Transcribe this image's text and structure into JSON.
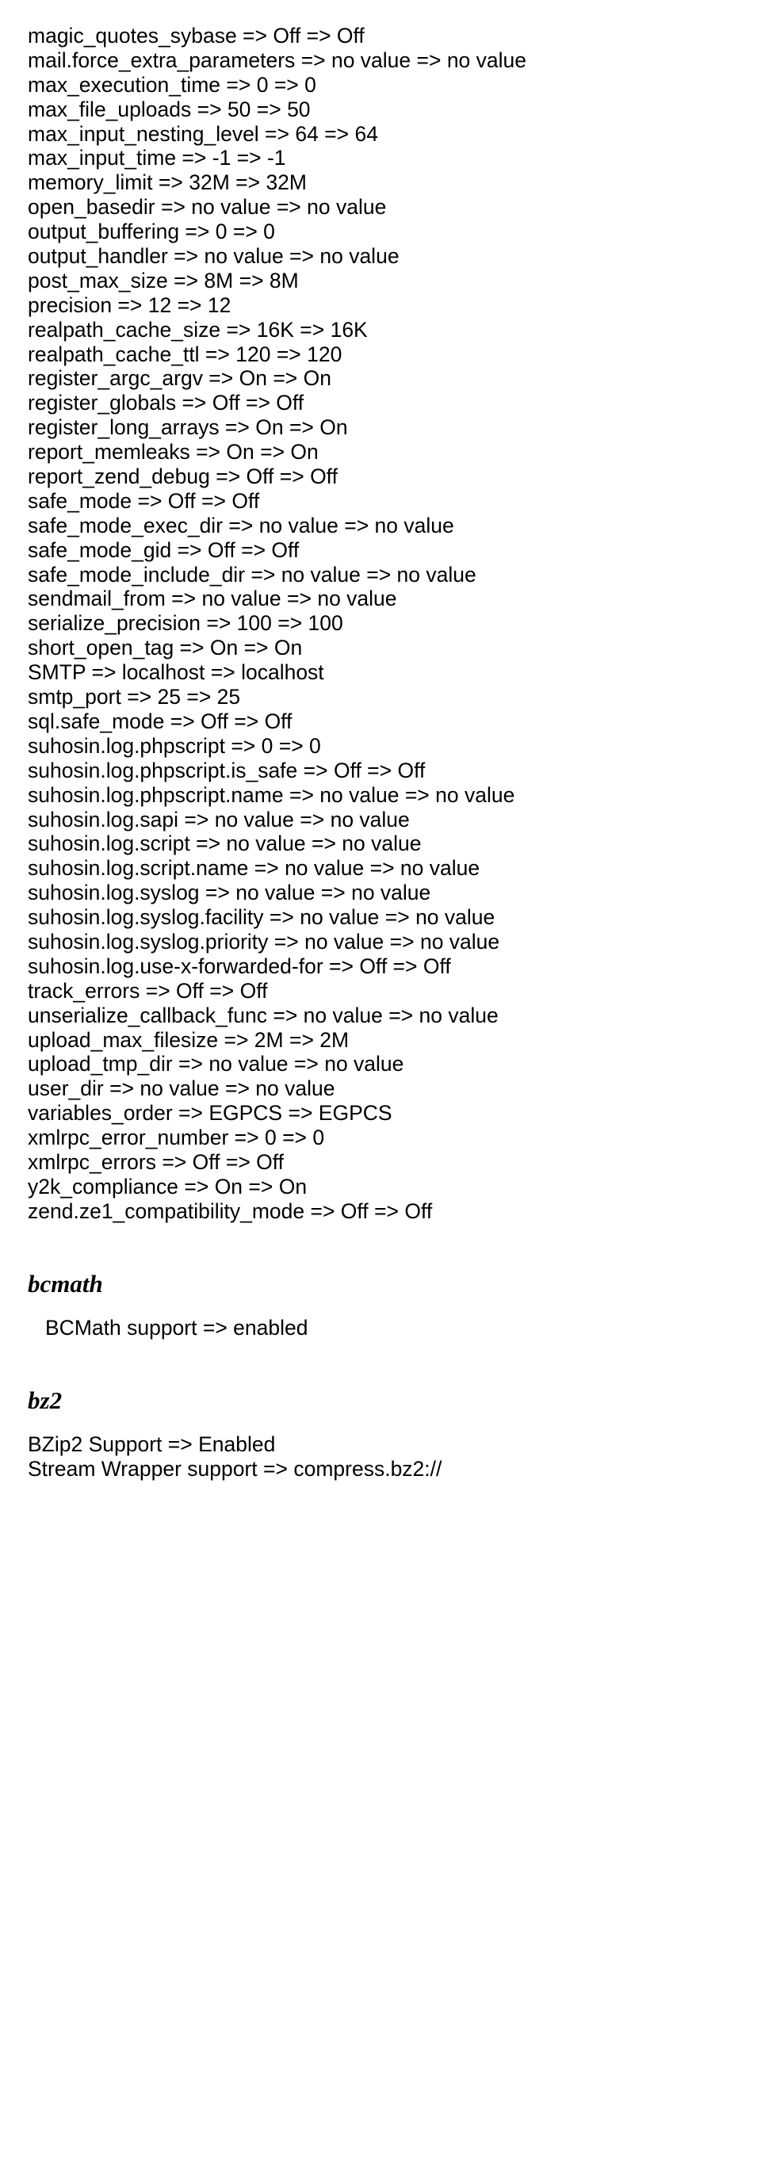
{
  "lines": [
    "magic_quotes_sybase => Off => Off",
    "mail.force_extra_parameters => no value => no value",
    "max_execution_time => 0 => 0",
    "max_file_uploads => 50 => 50",
    "max_input_nesting_level => 64 => 64",
    "max_input_time => -1 => -1",
    "memory_limit => 32M => 32M",
    "open_basedir => no value => no value",
    "output_buffering => 0 => 0",
    "output_handler => no value => no value",
    "post_max_size => 8M => 8M",
    "precision => 12 => 12",
    "realpath_cache_size => 16K => 16K",
    "realpath_cache_ttl => 120 => 120",
    "register_argc_argv => On => On",
    "register_globals => Off => Off",
    "register_long_arrays => On => On",
    "report_memleaks => On => On",
    "report_zend_debug => Off => Off",
    "safe_mode => Off => Off",
    "safe_mode_exec_dir => no value => no value",
    "safe_mode_gid => Off => Off",
    "safe_mode_include_dir => no value => no value",
    "sendmail_from => no value => no value",
    "serialize_precision => 100 => 100",
    "short_open_tag => On => On",
    "SMTP => localhost => localhost",
    "smtp_port => 25 => 25",
    "sql.safe_mode => Off => Off",
    "suhosin.log.phpscript => 0 => 0",
    "suhosin.log.phpscript.is_safe => Off => Off",
    "suhosin.log.phpscript.name => no value => no value",
    "suhosin.log.sapi => no value => no value",
    "suhosin.log.script => no value => no value",
    "suhosin.log.script.name => no value => no value",
    "suhosin.log.syslog => no value => no value",
    "suhosin.log.syslog.facility => no value => no value",
    "suhosin.log.syslog.priority => no value => no value",
    "suhosin.log.use-x-forwarded-for => Off => Off",
    "track_errors => Off => Off",
    "unserialize_callback_func => no value => no value",
    "upload_max_filesize => 2M => 2M",
    "upload_tmp_dir => no value => no value",
    "user_dir => no value => no value",
    "variables_order => EGPCS => EGPCS",
    "xmlrpc_error_number => 0 => 0",
    "xmlrpc_errors => Off => Off",
    "y2k_compliance => On => On",
    "zend.ze1_compatibility_mode => Off => Off"
  ],
  "sections": [
    {
      "heading": "bcmath",
      "sub_lines": [
        "BCMath support => enabled"
      ]
    },
    {
      "heading": "bz2",
      "sub_lines": [
        "BZip2 Support => Enabled",
        "Stream Wrapper support => compress.bz2://"
      ]
    }
  ]
}
